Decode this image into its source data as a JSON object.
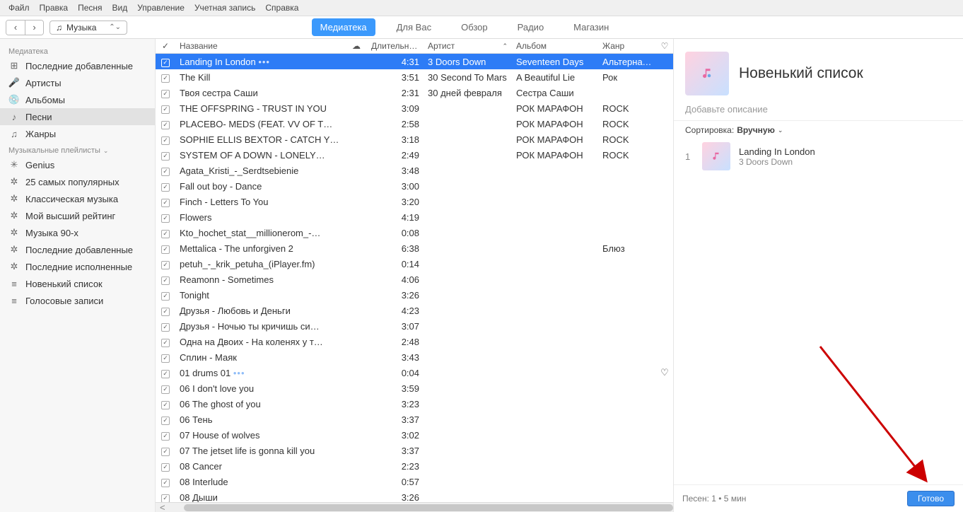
{
  "menu": [
    "Файл",
    "Правка",
    "Песня",
    "Вид",
    "Управление",
    "Учетная запись",
    "Справка"
  ],
  "library_selector": {
    "icon": "♫",
    "label": "Музыка"
  },
  "tabs": [
    {
      "label": "Медиатека",
      "active": true
    },
    {
      "label": "Для Вас",
      "active": false
    },
    {
      "label": "Обзор",
      "active": false
    },
    {
      "label": "Радио",
      "active": false
    },
    {
      "label": "Магазин",
      "active": false
    }
  ],
  "sidebar": {
    "section1_label": "Медиатека",
    "section1": [
      {
        "icon": "⊞",
        "label": "Последние добавленные"
      },
      {
        "icon": "🎤",
        "label": "Артисты"
      },
      {
        "icon": "💿",
        "label": "Альбомы"
      },
      {
        "icon": "♪",
        "label": "Песни",
        "sel": true
      },
      {
        "icon": "♫",
        "label": "Жанры"
      }
    ],
    "section2_label": "Музыкальные плейлисты",
    "section2": [
      {
        "icon": "✳",
        "label": "Genius"
      },
      {
        "icon": "✲",
        "label": "25 самых популярных"
      },
      {
        "icon": "✲",
        "label": "Классическая музыка"
      },
      {
        "icon": "✲",
        "label": "Мой высший рейтинг"
      },
      {
        "icon": "✲",
        "label": "Музыка 90-х"
      },
      {
        "icon": "✲",
        "label": "Последние добавленные"
      },
      {
        "icon": "✲",
        "label": "Последние исполненные"
      },
      {
        "icon": "≡",
        "label": "Новенький список"
      },
      {
        "icon": "≡",
        "label": "Голосовые записи"
      }
    ]
  },
  "columns": {
    "chk": "✓",
    "name": "Название",
    "cloud": "☁",
    "dur": "Длительность",
    "artist": "Артист",
    "album": "Альбом",
    "genre": "Жанр",
    "heart": "♡"
  },
  "tracks": [
    {
      "name": "Landing In London",
      "dur": "4:31",
      "artist": "3 Doors Down",
      "album": "Seventeen Days",
      "genre": "Альтернат…",
      "sel": true,
      "dots": true
    },
    {
      "name": "The Kill",
      "dur": "3:51",
      "artist": "30 Second To Mars",
      "album": "A Beautiful Lie",
      "genre": "Рок"
    },
    {
      "name": "Твоя сестра Саши",
      "dur": "2:31",
      "artist": "30 дней февраля",
      "album": "Сестра Саши",
      "genre": ""
    },
    {
      "name": "THE OFFSPRING - TRUST IN YOU",
      "dur": "3:09",
      "artist": "",
      "album": "РОК МАРАФОН",
      "genre": "ROCK"
    },
    {
      "name": "PLACEBO- MEDS (FEAT. VV OF T…",
      "dur": "2:58",
      "artist": "",
      "album": "РОК МАРАФОН",
      "genre": "ROCK"
    },
    {
      "name": "SOPHIE ELLIS BEXTOR - CATCH Y…",
      "dur": "3:18",
      "artist": "",
      "album": "РОК МАРАФОН",
      "genre": "ROCK"
    },
    {
      "name": "SYSTEM OF A DOWN - LONELY…",
      "dur": "2:49",
      "artist": "",
      "album": "РОК МАРАФОН",
      "genre": "ROCK"
    },
    {
      "name": "Agata_Kristi_-_Serdtsebienie",
      "dur": "3:48",
      "artist": "",
      "album": "",
      "genre": ""
    },
    {
      "name": "Fall out boy - Dance",
      "dur": "3:00",
      "artist": "",
      "album": "",
      "genre": ""
    },
    {
      "name": "Finch - Letters To You",
      "dur": "3:20",
      "artist": "",
      "album": "",
      "genre": ""
    },
    {
      "name": "Flowers",
      "dur": "4:19",
      "artist": "",
      "album": "",
      "genre": ""
    },
    {
      "name": "Kto_hochet_stat__millionerom_-…",
      "dur": "0:08",
      "artist": "",
      "album": "",
      "genre": ""
    },
    {
      "name": "Mettalica - The unforgiven 2",
      "dur": "6:38",
      "artist": "",
      "album": "",
      "genre": "Блюз"
    },
    {
      "name": "petuh_-_krik_petuha_(iPlayer.fm)",
      "dur": "0:14",
      "artist": "",
      "album": "",
      "genre": ""
    },
    {
      "name": "Reamonn - Sometimes",
      "dur": "4:06",
      "artist": "",
      "album": "",
      "genre": ""
    },
    {
      "name": "Tonight",
      "dur": "3:26",
      "artist": "",
      "album": "",
      "genre": ""
    },
    {
      "name": "Друзья - Любовь и Деньги",
      "dur": "4:23",
      "artist": "",
      "album": "",
      "genre": ""
    },
    {
      "name": "Друзья - Ночью ты кричишь си…",
      "dur": "3:07",
      "artist": "",
      "album": "",
      "genre": ""
    },
    {
      "name": "Одна на Двоих - На коленях у т…",
      "dur": "2:48",
      "artist": "",
      "album": "",
      "genre": ""
    },
    {
      "name": "Сплин - Маяк",
      "dur": "3:43",
      "artist": "",
      "album": "",
      "genre": ""
    },
    {
      "name": "01 drums 01",
      "dur": "0:04",
      "artist": "",
      "album": "",
      "genre": "",
      "dots": true,
      "heart": true
    },
    {
      "name": "06 I don't love you",
      "dur": "3:59",
      "artist": "",
      "album": "",
      "genre": ""
    },
    {
      "name": "06 The ghost of you",
      "dur": "3:23",
      "artist": "",
      "album": "",
      "genre": ""
    },
    {
      "name": "06 Тень",
      "dur": "3:37",
      "artist": "",
      "album": "",
      "genre": ""
    },
    {
      "name": "07 House of wolves",
      "dur": "3:02",
      "artist": "",
      "album": "",
      "genre": ""
    },
    {
      "name": "07 The jetset life is gonna kill you",
      "dur": "3:37",
      "artist": "",
      "album": "",
      "genre": ""
    },
    {
      "name": "08 Cancer",
      "dur": "2:23",
      "artist": "",
      "album": "",
      "genre": ""
    },
    {
      "name": "08 Interlude",
      "dur": "0:57",
      "artist": "",
      "album": "",
      "genre": ""
    },
    {
      "name": "08 Дыши",
      "dur": "3:26",
      "artist": "",
      "album": "",
      "genre": ""
    }
  ],
  "playlist": {
    "title": "Новенький список",
    "desc": "Добавьте описание",
    "sort_label": "Сортировка:",
    "sort_value": "Вручную",
    "items": [
      {
        "n": "1",
        "title": "Landing In London",
        "artist": "3 Doors Down"
      }
    ],
    "footer": "Песен: 1 • 5 мин",
    "done": "Готово"
  }
}
